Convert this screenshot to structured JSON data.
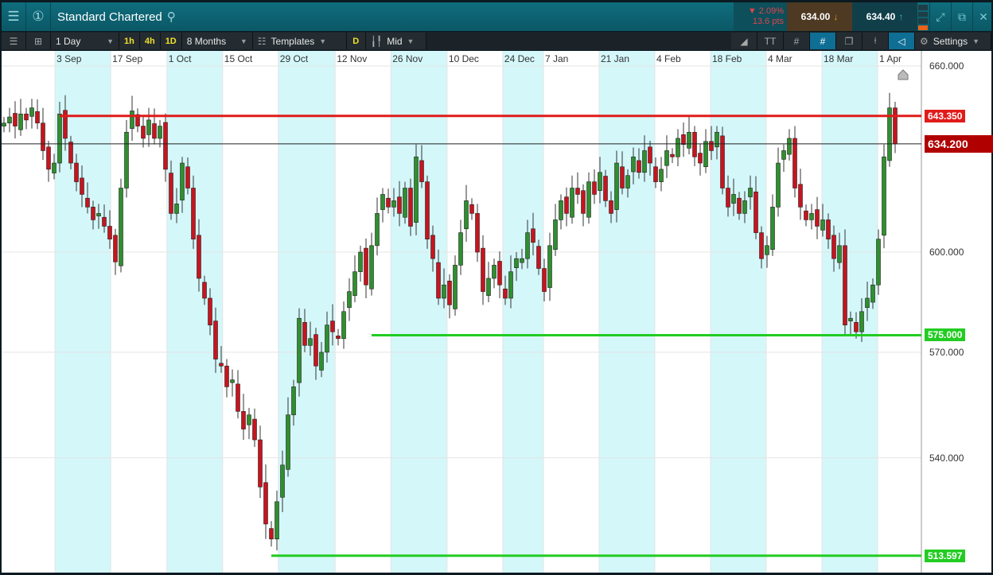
{
  "title": "Standard Chartered",
  "quote": {
    "change_pct": "▼ 2.09%",
    "change_pts": "13.6 pts",
    "sell": "634.00",
    "buy": "634.40",
    "sell_color": "#e3a21a",
    "buy_color": "#35b6d0"
  },
  "toolbar": {
    "interval": "1 Day",
    "quick": [
      "1h",
      "4h",
      "1D"
    ],
    "range": "8 Months",
    "templates": "Templates",
    "d": "D",
    "price_type": "Mid",
    "settings": "Settings"
  },
  "chart_data": {
    "type": "candlestick",
    "scale": "log",
    "ylim": [
      508,
      668
    ],
    "yticks": [
      "660.000",
      "600.000",
      "570.000",
      "540.000"
    ],
    "ytick_values": [
      660,
      600,
      570,
      540
    ],
    "date_labels": [
      {
        "t": "3 Sep",
        "i": 9.3
      },
      {
        "t": "17 Sep",
        "i": 19.3
      },
      {
        "t": "1 Oct",
        "i": 29.4
      },
      {
        "t": "15 Oct",
        "i": 39.4
      },
      {
        "t": "29 Oct",
        "i": 49.4
      },
      {
        "t": "12 Nov",
        "i": 59.6
      },
      {
        "t": "26 Nov",
        "i": 69.6
      },
      {
        "t": "10 Dec",
        "i": 79.7
      },
      {
        "t": "24 Dec",
        "i": 89.7
      },
      {
        "t": "7 Jan",
        "i": 97
      },
      {
        "t": "21 Jan",
        "i": 107
      },
      {
        "t": "4 Feb",
        "i": 117
      },
      {
        "t": "18 Feb",
        "i": 127
      },
      {
        "t": "4 Mar",
        "i": 137
      },
      {
        "t": "18 Mar",
        "i": 147
      },
      {
        "t": "1 Apr",
        "i": 157
      }
    ],
    "closes": [
      641,
      643,
      640,
      644,
      642,
      646,
      641,
      632,
      626,
      628,
      644,
      636,
      628,
      622,
      618,
      614,
      610,
      612,
      608,
      604,
      597,
      620,
      638,
      645,
      640,
      636,
      642,
      636,
      640,
      626,
      612,
      615,
      628,
      620,
      604,
      592,
      586,
      578,
      568,
      566,
      560,
      562,
      553,
      548,
      552,
      545,
      532,
      522,
      518,
      528,
      538,
      552,
      560,
      580,
      572,
      574,
      566,
      570,
      578,
      576,
      574,
      582,
      588,
      594,
      600,
      590,
      602,
      612,
      618,
      614,
      616,
      612,
      620,
      608,
      630,
      622,
      604,
      598,
      586,
      590,
      584,
      596,
      606,
      616,
      612,
      600,
      588,
      592,
      596,
      590,
      586,
      594,
      598,
      598,
      606,
      603,
      595,
      588,
      602,
      610,
      616,
      612,
      620,
      618,
      612,
      622,
      618,
      625,
      616,
      612,
      628,
      620,
      624,
      630,
      625,
      632,
      628,
      622,
      626,
      632,
      630,
      636,
      634,
      638,
      630,
      628,
      635,
      632,
      638,
      620,
      614,
      618,
      612,
      616,
      620,
      606,
      598,
      602,
      614,
      628,
      632,
      636,
      620,
      614,
      610,
      612,
      608,
      610,
      604,
      598,
      602,
      578,
      580,
      576,
      582,
      586,
      590,
      604,
      630,
      646,
      634.2
    ],
    "levels": [
      {
        "label": "643.350",
        "value": 643.35,
        "color": "#e01b1b",
        "from": 10
      },
      {
        "label": "634.200",
        "value": 634.2,
        "color": "#b00000",
        "from": 0,
        "current": true
      },
      {
        "label": "575.000",
        "value": 575,
        "color": "#22cc22",
        "from": 66
      },
      {
        "label": "513.597",
        "value": 513.597,
        "color": "#22cc22",
        "from": 48
      }
    ]
  }
}
